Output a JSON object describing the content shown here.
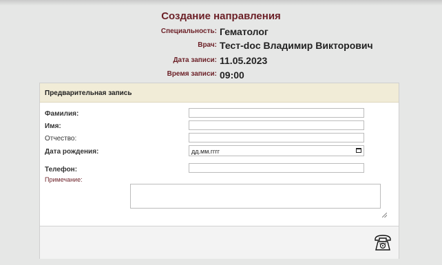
{
  "page": {
    "title": "Создание направления"
  },
  "summary": [
    {
      "label": "Специальность:",
      "value": "Гематолог"
    },
    {
      "label": "Врач:",
      "value": "Тест-doc Владимир Викторович"
    },
    {
      "label": "Дата записи:",
      "value": "11.05.2023"
    },
    {
      "label": "Время записи:",
      "value": "09:00"
    }
  ],
  "form": {
    "header": "Предварительная запись",
    "surname_label": "Фамилия:",
    "name_label": "Имя:",
    "patronymic_label": "Отчество:",
    "birthdate_label": "Дата рождения:",
    "birthdate_placeholder": "дд.мм.гггг",
    "phone_label": "Телефон:",
    "note_label": "Примечание:"
  },
  "icons": {
    "submit": "telephone-icon",
    "calendar": "calendar-icon"
  },
  "colors": {
    "accent": "#6b1f26",
    "header_bg": "#f1ecd7",
    "page_bg": "#e6e7e6"
  }
}
